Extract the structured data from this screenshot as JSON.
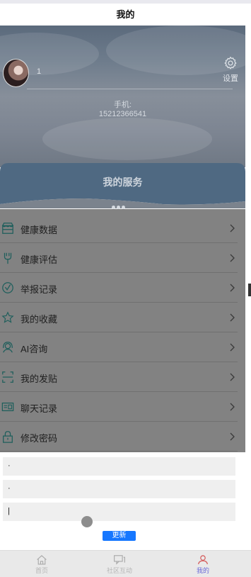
{
  "header": {
    "title": "我的"
  },
  "profile": {
    "username": "1",
    "settings_label": "设置",
    "phone_label": "手机:",
    "phone_value": "15212366541"
  },
  "services": {
    "title": "我的服务"
  },
  "menu": {
    "items": [
      {
        "label": "健康数据",
        "icon": "store-icon"
      },
      {
        "label": "健康评估",
        "icon": "tuning-fork-icon"
      },
      {
        "label": "举报记录",
        "icon": "clock-check-icon"
      },
      {
        "label": "我的收藏",
        "icon": "star-icon"
      },
      {
        "label": "AI咨询",
        "icon": "headset-icon"
      },
      {
        "label": "我的发贴",
        "icon": "scan-icon"
      },
      {
        "label": "聊天记录",
        "icon": "id-card-icon"
      },
      {
        "label": "修改密码",
        "icon": "lock-icon"
      }
    ]
  },
  "form": {
    "fields": [
      {
        "value": "·"
      },
      {
        "value": "·"
      },
      {
        "value": "|"
      }
    ],
    "update_label": "更新"
  },
  "tabbar": {
    "tabs": [
      {
        "label": "首页",
        "icon": "home-icon"
      },
      {
        "label": "社区互动",
        "icon": "chat-icon"
      },
      {
        "label": "我的",
        "icon": "user-icon"
      }
    ]
  },
  "colors": {
    "accent": "#1677ff",
    "icon_teal": "#1f6f6b",
    "tab_active": "#d45a5a"
  }
}
